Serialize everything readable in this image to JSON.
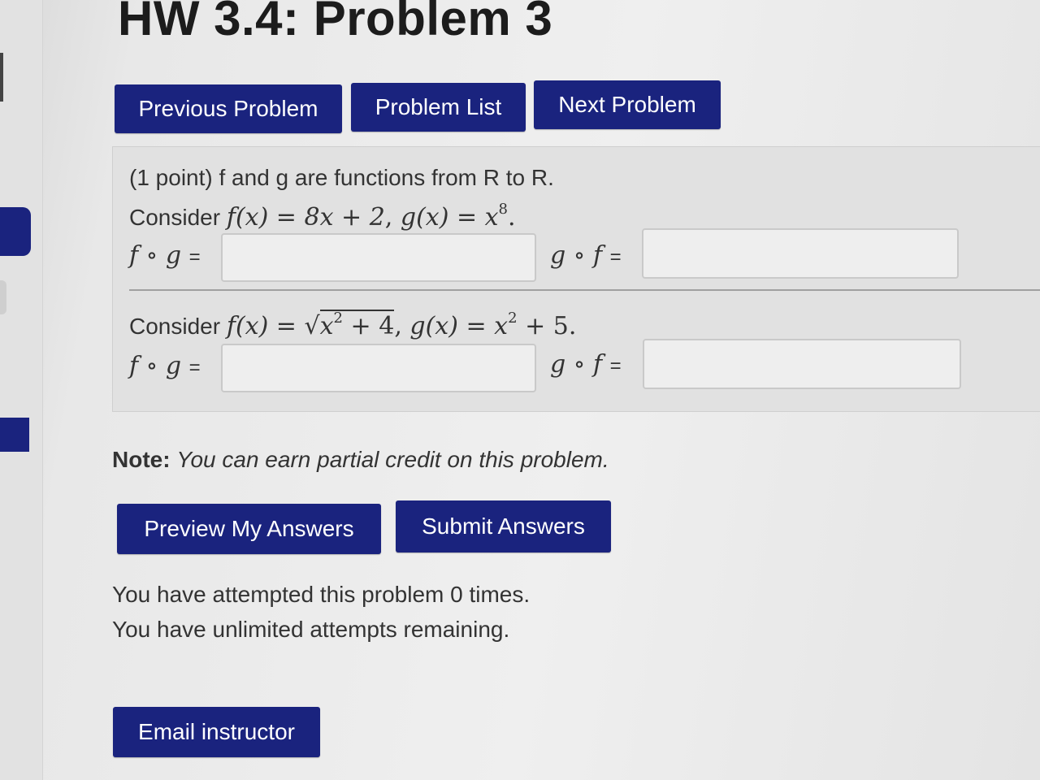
{
  "page": {
    "title": "HW 3.4: Problem 3"
  },
  "nav": {
    "previous_label": "Previous Problem",
    "list_label": "Problem List",
    "next_label": "Next Problem"
  },
  "problem": {
    "intro": "(1 point) f and g are functions from R to R.",
    "part1": {
      "consider_label": "Consider",
      "f_def": "f(x) = 8x + 2",
      "g_def_base": "g(x) = x",
      "g_exponent": "8",
      "fog_label": "f ∘ g",
      "gof_label": "g ∘ f",
      "equals": "=",
      "fog_value": "",
      "gof_value": ""
    },
    "part2": {
      "consider_label": "Consider",
      "f_def_prefix": "f(x) =",
      "radicand_base": "x",
      "radicand_exponent": "2",
      "radicand_rest": "+ 4",
      "g_def_base": "g(x) = x",
      "g_exponent": "2",
      "g_def_rest": "+ 5.",
      "fog_label": "f ∘ g",
      "gof_label": "g ∘ f",
      "equals": "=",
      "fog_value": "",
      "gof_value": ""
    }
  },
  "note": {
    "label": "Note:",
    "text": "You can earn partial credit on this problem."
  },
  "actions": {
    "preview_label": "Preview My Answers",
    "submit_label": "Submit Answers"
  },
  "attempts": {
    "line1": "You have attempted this problem 0 times.",
    "line2": "You have unlimited attempts remaining."
  },
  "footer": {
    "email_label": "Email instructor"
  },
  "colors": {
    "button_bg": "#1a237e",
    "button_text": "#ffffff",
    "panel_bg": "#e1e1e1"
  }
}
